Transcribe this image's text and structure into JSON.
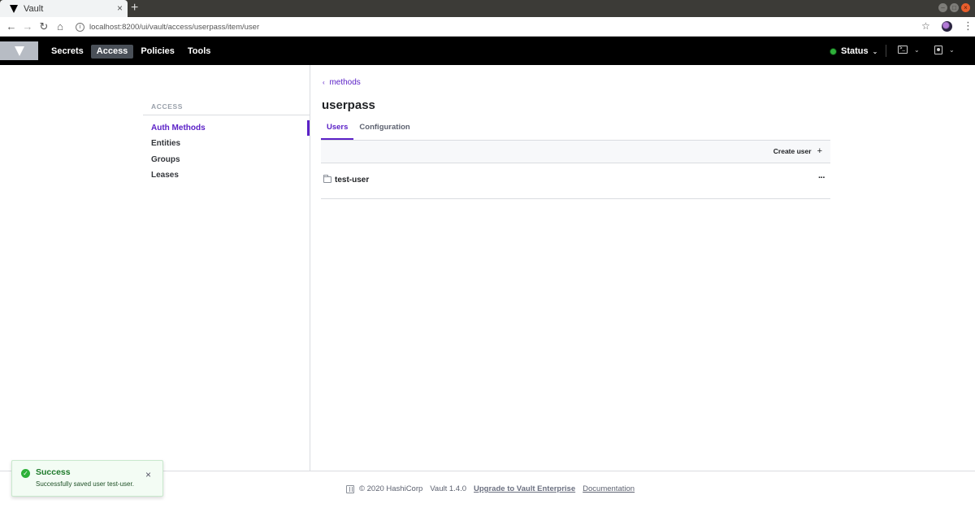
{
  "browser": {
    "tab_title": "Vault",
    "tab_close": "×",
    "new_tab": "+",
    "url": "localhost:8200/ui/vault/access/userpass/item/user",
    "info_icon": "i",
    "star": "☆",
    "menu": "⋮",
    "nav": {
      "back": "←",
      "forward": "→",
      "reload": "↻",
      "home": "⌂"
    },
    "window": {
      "minimize": "–",
      "maximize": "□",
      "close": "×"
    }
  },
  "header": {
    "nav": [
      "Secrets",
      "Access",
      "Policies",
      "Tools"
    ],
    "active_nav": "Access",
    "status_label": "Status",
    "status_color": "#2eb039",
    "chevron": "⌄",
    "console_glyph": ">_"
  },
  "sidebar": {
    "section": "ACCESS",
    "items": [
      "Auth Methods",
      "Entities",
      "Groups",
      "Leases"
    ],
    "active_item": "Auth Methods"
  },
  "main": {
    "breadcrumb": "methods",
    "breadcrumb_chevron": "‹",
    "title": "userpass",
    "tabs": [
      "Users",
      "Configuration"
    ],
    "active_tab": "Users",
    "create_user": "Create user",
    "create_user_plus": "+",
    "rows": [
      {
        "label": "test-user",
        "menu": "···"
      }
    ]
  },
  "footer": {
    "copyright": "© 2020 HashiCorp",
    "version": "Vault 1.4.0",
    "upgrade": "Upgrade to Vault Enterprise",
    "docs": "Documentation"
  },
  "toast": {
    "title": "Success",
    "message": "Successfully saved user test-user.",
    "check": "✓",
    "close": "×"
  },
  "colors": {
    "accent": "#5b21c7",
    "header_bg": "#000000",
    "success": "#2eb039"
  }
}
